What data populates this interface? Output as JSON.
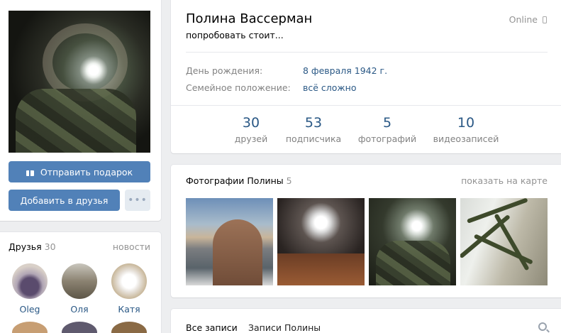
{
  "profile": {
    "name": "Полина Вассерман",
    "status": "попробовать стоит...",
    "online": "Online",
    "info": [
      {
        "label": "День рождения:",
        "value": "8 февраля 1942 г."
      },
      {
        "label": "Семейное положение:",
        "value": "всё сложно"
      }
    ],
    "counters": [
      {
        "num": "30",
        "label": "друзей"
      },
      {
        "num": "53",
        "label": "подписчика"
      },
      {
        "num": "5",
        "label": "фотографий"
      },
      {
        "num": "10",
        "label": "видеозаписей"
      }
    ]
  },
  "actions": {
    "gift": "Отправить подарок",
    "add_friend": "Добавить в друзья",
    "more": "•••"
  },
  "friends": {
    "title": "Друзья",
    "count": "30",
    "news": "новости",
    "items": [
      {
        "name": "Oleg"
      },
      {
        "name": "Оля"
      },
      {
        "name": "Катя"
      }
    ]
  },
  "photos": {
    "title": "Фотографии Полины",
    "count": "5",
    "map_link": "показать на карте"
  },
  "wall": {
    "tabs": [
      "Все записи",
      "Записи Полины"
    ]
  },
  "colors": {
    "accent": "#5181b8",
    "link": "#2a5885",
    "background": "#edeef0"
  }
}
